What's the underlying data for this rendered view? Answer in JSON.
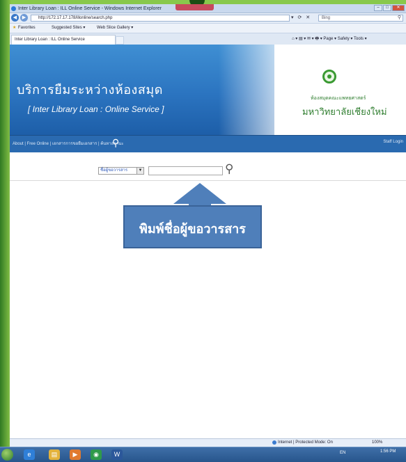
{
  "browser": {
    "window_title": "Inter Library Loan : ILL Online Service - Windows Internet Explorer",
    "url": "http://172.17.17.178/illonline/search.php",
    "search_placeholder": "Bing",
    "favorites_label": "Favorites",
    "suggested_sites": "Suggested Sites ▾",
    "web_slice": "Web Slice Gallery ▾",
    "tab_title": "Inter Library Loan : ILL Online Service",
    "command_bar": "Page ▾  Safety ▾  Tools ▾"
  },
  "site": {
    "title_th": "บริการยืมระหว่างห้องสมุด",
    "title_en": "[ Inter Library Loan : Online Service ]",
    "logo_line1": "ห้องสมุดคณะแพทยศาสตร์",
    "logo_line2": "มหาวิทยาลัยเชียงใหม่",
    "menu_links": "About | Free Online | เอกสารการขอยืมเอกสาร | ค้นหาสถานะ",
    "staff_login": "Staff Login"
  },
  "search": {
    "field_selected": "ชื่อผู้ขอวารสาร",
    "query_value": ""
  },
  "callout": {
    "text": "พิมพ์ชื่อผู้ขอวารสาร"
  },
  "status": {
    "zone": "Internet | Protected Mode: On",
    "zoom": "100%"
  },
  "taskbar": {
    "tray": "EN",
    "time": "1:56 PM"
  }
}
